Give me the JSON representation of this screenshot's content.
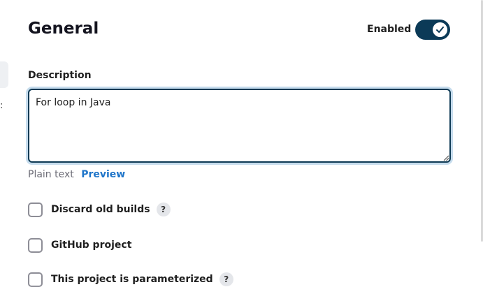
{
  "section": {
    "title": "General",
    "enabled_label": "Enabled",
    "enabled": true
  },
  "description": {
    "label": "Description",
    "value": "For loop in Java",
    "format_label": "Plain text",
    "preview_label": "Preview"
  },
  "options": [
    {
      "label": "Discard old builds",
      "checked": false,
      "help": "?"
    },
    {
      "label": "GitHub project",
      "checked": false
    },
    {
      "label": "This project is parameterized",
      "checked": false,
      "help": "?"
    }
  ],
  "colors": {
    "accent": "#0b3a57",
    "link": "#1f75c9",
    "focus_ring": "#c6dced"
  },
  "icons": {
    "toggle": "checkmark-icon",
    "help": "question-mark-icon",
    "resize": "resize-grip-icon"
  }
}
